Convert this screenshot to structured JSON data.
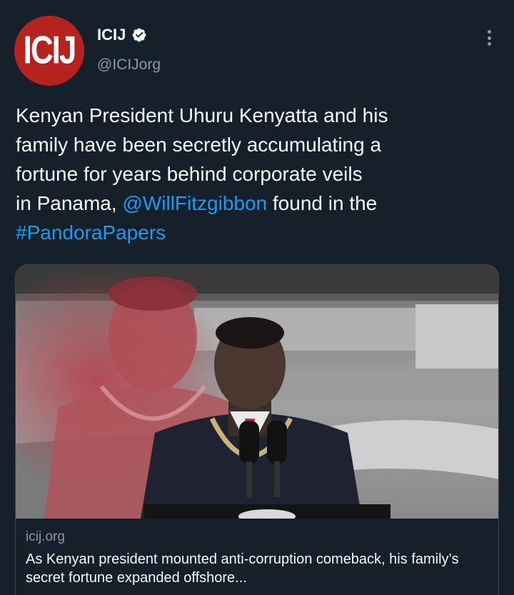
{
  "author": {
    "avatar_text": "ICIJ",
    "display_name": "ICIJ",
    "handle": "@ICIJorg",
    "verified": true
  },
  "tweet": {
    "lines": [
      {
        "text": "Kenyan President Uhuru Kenyatta and his"
      },
      {
        "text": "family have been secretly accumulating a"
      },
      {
        "text": "fortune for years behind corporate veils"
      },
      {
        "prefix": "in Panama, ",
        "mention": "@WillFitzgibbon",
        "suffix": " found in the"
      },
      {
        "hashtag": "#PandoraPapers"
      }
    ]
  },
  "card": {
    "domain": "icij.org",
    "title": "As Kenyan president mounted anti-corruption comeback, his family’s secret fortune expanded offshore..."
  },
  "colors": {
    "background": "#15202b",
    "link": "#1d9bf0",
    "avatar": "#b6221d",
    "secondary_text": "#8b98a5"
  },
  "icons": [
    "verified-badge-icon",
    "more-options-icon"
  ]
}
